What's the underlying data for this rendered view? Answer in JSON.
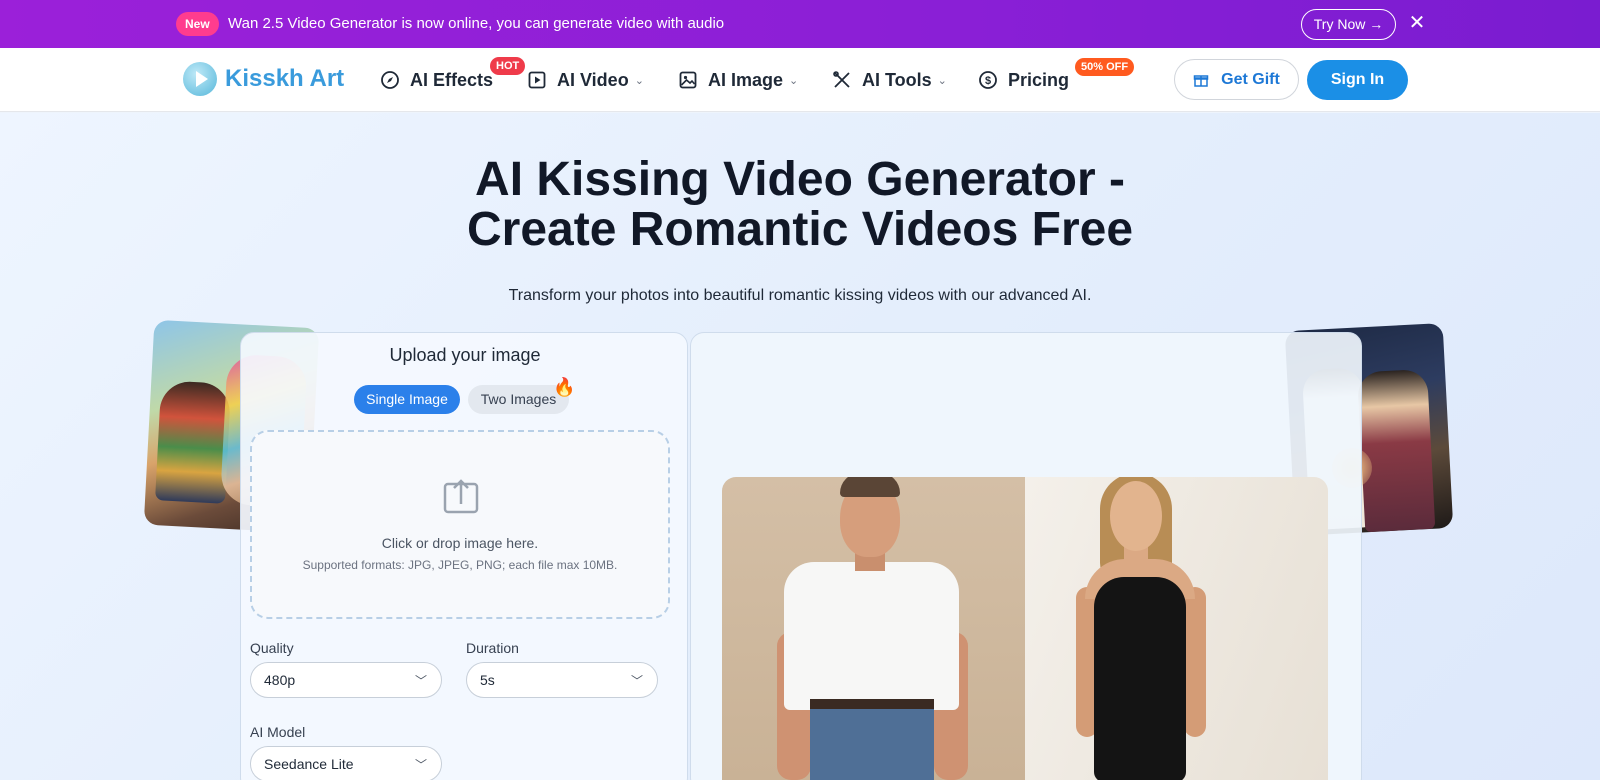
{
  "announcement": {
    "badge": "New",
    "message": "Wan 2.5 Video Generator is now online, you can generate video with audio",
    "cta": "Try Now →",
    "close": "✕"
  },
  "nav": {
    "logo_text": "Kisskh Art",
    "items": [
      {
        "label": "AI Effects",
        "badge": "HOT"
      },
      {
        "label": "AI Video"
      },
      {
        "label": "AI Image"
      },
      {
        "label": "AI Tools"
      },
      {
        "label": "Pricing",
        "badge": "50% OFF"
      }
    ],
    "get_gift": "Get Gift",
    "sign_in": "Sign In"
  },
  "hero": {
    "title_line1": "AI Kissing Video Generator -",
    "title_line2": "Create Romantic Videos Free",
    "subtitle": "Transform your photos into beautiful romantic kissing videos with our advanced AI."
  },
  "upload": {
    "title": "Upload your image",
    "tabs": [
      "Single Image",
      "Two Images"
    ],
    "active_tab": "Single Image",
    "drop_text": "Click or drop image here.",
    "formats_text": "Supported formats: JPG, JPEG, PNG; each file max 10MB."
  },
  "settings": {
    "quality_label": "Quality",
    "quality_value": "480p",
    "duration_label": "Duration",
    "duration_value": "5s",
    "model_label": "AI Model",
    "model_value": "Seedance Lite"
  },
  "colors": {
    "announce_bg": "#8a1fd6",
    "new_badge": "#ff3c8e",
    "brand_blue": "#1b8fe6",
    "logo_blue": "#3a9bdc",
    "hot_badge": "#ef3b4a",
    "off_badge": "#ff5a1f",
    "tab_active": "#2b80ea"
  },
  "icons": {
    "effects": "compass-icon",
    "video": "play-square-icon",
    "image": "image-icon",
    "tools": "tools-icon",
    "pricing": "dollar-circle-icon",
    "gift": "gift-icon",
    "upload": "upload-icon",
    "fire": "fire-icon"
  }
}
